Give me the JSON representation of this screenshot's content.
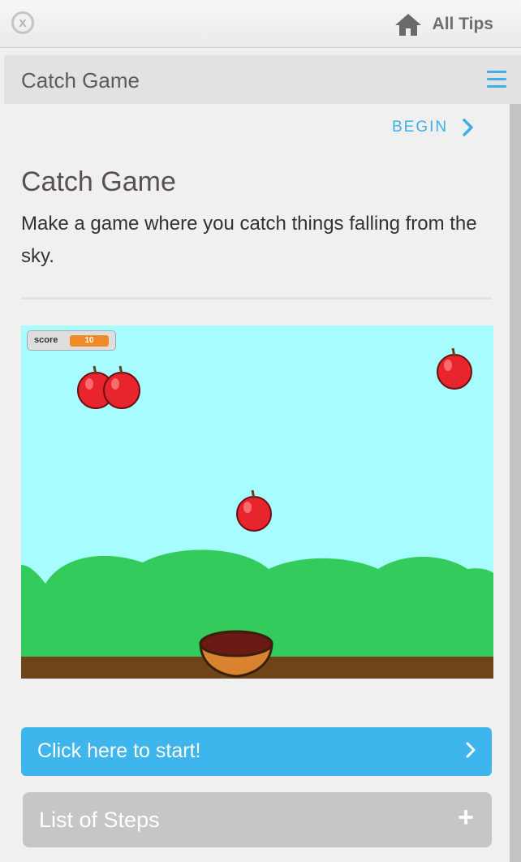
{
  "topbar": {
    "close_symbol": "x",
    "all_tips_label": "All Tips",
    "icons": [
      "close-icon",
      "home-icon"
    ]
  },
  "panel": {
    "title": "Catch Game",
    "menu_icon": "hamburger-menu-icon",
    "begin_label": "BEGIN",
    "heading": "Catch Game",
    "description": "Make a game where you catch things falling from the sky."
  },
  "stage": {
    "score_label": "score",
    "score_value": "10",
    "sprites": [
      "apple",
      "apple",
      "apple",
      "apple",
      "bowl"
    ],
    "colors": {
      "sky": "#a6fcff",
      "hills": "#33cc5c",
      "ground": "#6f4418",
      "apple": "#e8242c",
      "bowl": "#d9822f"
    }
  },
  "buttons": {
    "start_label": "Click here to start!",
    "steps_label": "List of Steps",
    "steps_symbol": "+"
  },
  "colors": {
    "accent": "#3eb5ec",
    "secondary_button": "#c6c6c8"
  }
}
